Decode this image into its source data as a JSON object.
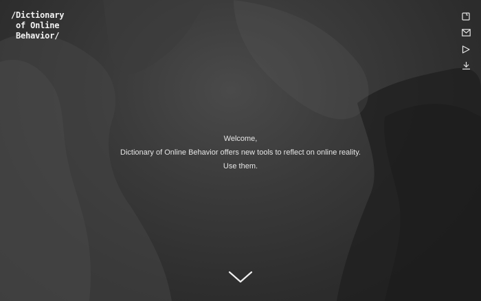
{
  "brand": {
    "logo_text": "/Dictionary\n of Online\n Behavior/"
  },
  "icons": [
    {
      "name": "bookmark-icon"
    },
    {
      "name": "mail-icon"
    },
    {
      "name": "play-icon"
    },
    {
      "name": "download-icon"
    }
  ],
  "welcome": {
    "line1": "Welcome,",
    "line2": "Dictionary of Online Behavior offers new tools to reflect on online reality.",
    "line3": "Use them."
  },
  "scroll": {
    "icon": "chevron-down-icon"
  },
  "colors": {
    "background": "#2e2e2e",
    "text": "#e6e6e6",
    "logo": "#f2f2f2"
  }
}
